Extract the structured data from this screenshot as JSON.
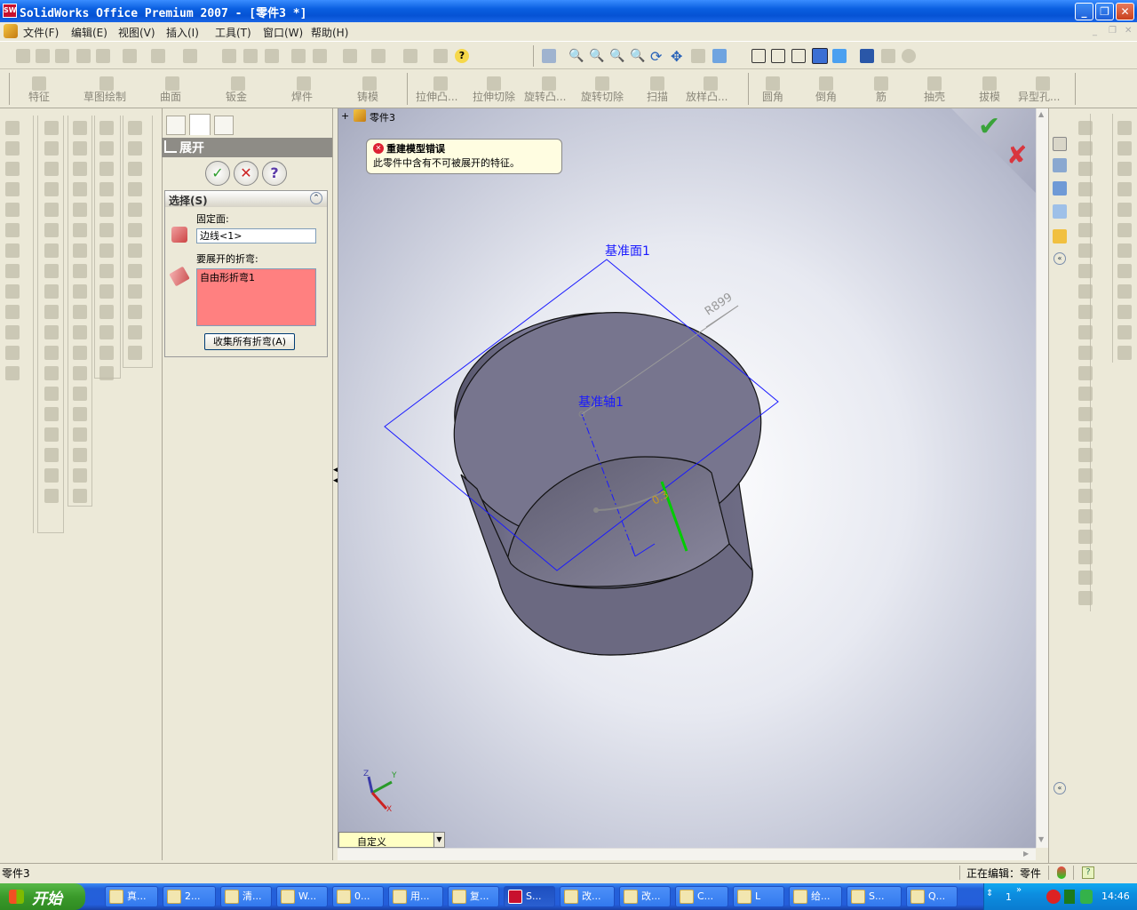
{
  "window": {
    "title": "SolidWorks Office Premium 2007 - [零件3 *]",
    "app_icon": "solidworks-icon"
  },
  "menu": {
    "items": [
      "文件(F)",
      "编辑(E)",
      "视图(V)",
      "插入(I)",
      "工具(T)",
      "窗口(W)",
      "帮助(H)"
    ]
  },
  "command_manager": {
    "tabs": [
      "特征",
      "草图绘制",
      "曲面",
      "钣金",
      "焊件",
      "铸模"
    ],
    "feature_buttons": [
      "拉伸凸...",
      "拉伸切除",
      "旋转凸...",
      "旋转切除",
      "扫描",
      "放样凸...",
      "圆角",
      "倒角",
      "筋",
      "抽壳",
      "拔模",
      "异型孔..."
    ]
  },
  "feature_tree": {
    "part_name": "零件3"
  },
  "property_manager": {
    "title": "展开",
    "section_title": "选择(S)",
    "fixed_face_label": "固定面:",
    "fixed_face_value": "边线<1>",
    "bends_label": "要展开的折弯:",
    "bends_list": [
      "自由形折弯1"
    ],
    "collect_button": "收集所有折弯(A)",
    "ok_icon": "ok-check-icon",
    "cancel_icon": "cancel-x-icon",
    "help_icon": "help-question-icon"
  },
  "error_callout": {
    "title": "重建模型错误",
    "message": "此零件中含有不可被展开的特征。"
  },
  "viewport": {
    "plane_label": "基准面1",
    "axis_label": "基准轴1",
    "dimension_label": "R899",
    "view_orientation": "自定义",
    "axis_triad": [
      "Y",
      "Z",
      "X"
    ],
    "accent_colors": {
      "plane": "#1a1aff",
      "edge_highlight": "#00cc00",
      "confirm_check": "#3aa33a",
      "confirm_x": "#d9363e",
      "part": "#6e6c84"
    }
  },
  "status_bar": {
    "left_text": "零件3",
    "right_text": "正在编辑：零件"
  },
  "taskbar": {
    "start_label": "开始",
    "tasks": [
      "真...",
      "2...",
      "清...",
      "W...",
      "0...",
      "用...",
      "复...",
      "S...",
      "改...",
      "改...",
      "C...",
      "L",
      "给...",
      "S...",
      "Q..."
    ],
    "active_task_index": 7,
    "tray_number": "1",
    "clock": "14:46"
  }
}
